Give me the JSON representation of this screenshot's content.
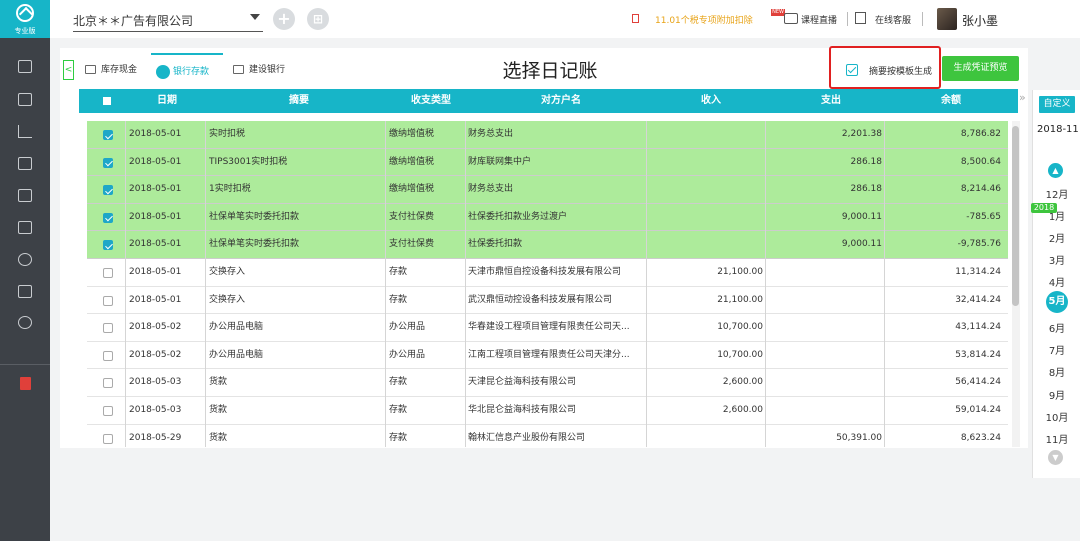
{
  "sidebar": {
    "version_label": "专业版"
  },
  "header": {
    "company": "北京＊＊广告有限公司",
    "add_icon": "+",
    "notice": "11.01个税专项附加扣除",
    "new_badge": "NEW",
    "live_label": "课程直播",
    "service_label": "在线客服",
    "username": "张小墨"
  },
  "tabs": [
    {
      "label": "库存现金"
    },
    {
      "label": "银行存款"
    },
    {
      "label": "建设银行"
    }
  ],
  "page_title": "选择日记账",
  "summary_checkbox_label": "摘要按模板生成",
  "generate_button": "生成凭证预览",
  "table": {
    "headers": [
      "日期",
      "摘要",
      "收支类型",
      "对方户名",
      "收入",
      "支出",
      "余额"
    ],
    "rows": [
      {
        "sel": true,
        "date": "2018-05-01",
        "summary": "实时扣税",
        "type": "缴纳增值税",
        "party": "财务总支出",
        "income": "",
        "expense": "2,201.38",
        "balance": "8,786.82"
      },
      {
        "sel": true,
        "date": "2018-05-01",
        "summary": "TIPS3001实时扣税",
        "type": "缴纳增值税",
        "party": "财库联网集中户",
        "income": "",
        "expense": "286.18",
        "balance": "8,500.64"
      },
      {
        "sel": true,
        "date": "2018-05-01",
        "summary": "1实时扣税",
        "type": "缴纳增值税",
        "party": "财务总支出",
        "income": "",
        "expense": "286.18",
        "balance": "8,214.46"
      },
      {
        "sel": true,
        "date": "2018-05-01",
        "summary": "社保单笔实时委托扣款",
        "type": "支付社保费",
        "party": "社保委托扣款业务过渡户",
        "income": "",
        "expense": "9,000.11",
        "balance": "-785.65"
      },
      {
        "sel": true,
        "date": "2018-05-01",
        "summary": "社保单笔实时委托扣款",
        "type": "支付社保费",
        "party": "社保委托扣款",
        "income": "",
        "expense": "9,000.11",
        "balance": "-9,785.76"
      },
      {
        "sel": false,
        "date": "2018-05-01",
        "summary": "交换存入",
        "type": "存款",
        "party": "天津市鼎恒自控设备科技发展有限公司",
        "income": "21,100.00",
        "expense": "",
        "balance": "11,314.24"
      },
      {
        "sel": false,
        "date": "2018-05-01",
        "summary": "交换存入",
        "type": "存款",
        "party": "武汉鼎恒动控设备科技发展有限公司",
        "income": "21,100.00",
        "expense": "",
        "balance": "32,414.24"
      },
      {
        "sel": false,
        "date": "2018-05-02",
        "summary": "办公用品电脑",
        "type": "办公用品",
        "party": "华春建设工程项目管理有限责任公司天...",
        "income": "10,700.00",
        "expense": "",
        "balance": "43,114.24"
      },
      {
        "sel": false,
        "date": "2018-05-02",
        "summary": "办公用品电脑",
        "type": "办公用品",
        "party": "江南工程项目管理有限责任公司天津分...",
        "income": "10,700.00",
        "expense": "",
        "balance": "53,814.24"
      },
      {
        "sel": false,
        "date": "2018-05-03",
        "summary": "货款",
        "type": "存款",
        "party": "天津昆仑益海科技有限公司",
        "income": "2,600.00",
        "expense": "",
        "balance": "56,414.24"
      },
      {
        "sel": false,
        "date": "2018-05-03",
        "summary": "货款",
        "type": "存款",
        "party": "华北昆仑益海科技有限公司",
        "income": "2,600.00",
        "expense": "",
        "balance": "59,014.24"
      },
      {
        "sel": false,
        "date": "2018-05-29",
        "summary": "货款",
        "type": "存款",
        "party": "翰林汇信息产业股份有限公司",
        "income": "",
        "expense": "50,391.00",
        "balance": "8,623.24"
      }
    ]
  },
  "month_panel": {
    "custom_button": "自定义",
    "current": "2018-11",
    "year_badge": "2018",
    "months": [
      "12月",
      "1月",
      "2月",
      "3月",
      "4月",
      "5月",
      "6月",
      "7月",
      "8月",
      "9月",
      "10月",
      "11月"
    ],
    "active_month": "5月"
  },
  "colors": {
    "accent": "#17b5c8",
    "selected_row": "#adeb9b",
    "primary_button": "#3ec53e",
    "highlight": "#e02020",
    "sidebar": "#3d4147"
  }
}
